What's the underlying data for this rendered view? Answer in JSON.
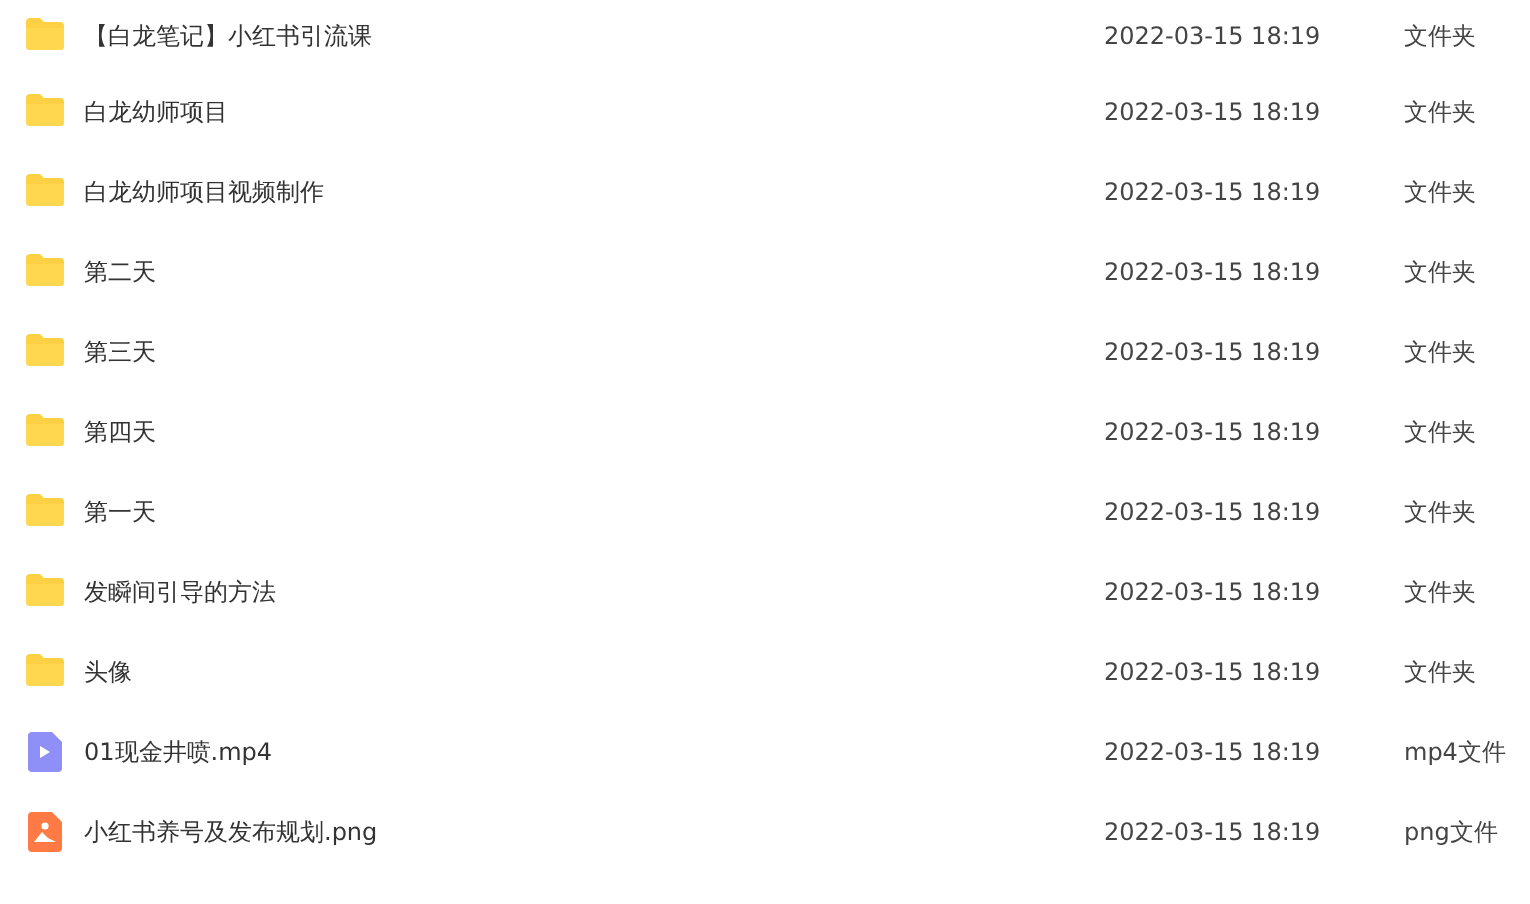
{
  "files": [
    {
      "kind": "folder",
      "name": "【白龙笔记】小红书引流课",
      "modified": "2022-03-15 18:19",
      "type": "文件夹"
    },
    {
      "kind": "folder",
      "name": "白龙幼师项目",
      "modified": "2022-03-15 18:19",
      "type": "文件夹"
    },
    {
      "kind": "folder",
      "name": "白龙幼师项目视频制作",
      "modified": "2022-03-15 18:19",
      "type": "文件夹"
    },
    {
      "kind": "folder",
      "name": "第二天",
      "modified": "2022-03-15 18:19",
      "type": "文件夹"
    },
    {
      "kind": "folder",
      "name": "第三天",
      "modified": "2022-03-15 18:19",
      "type": "文件夹"
    },
    {
      "kind": "folder",
      "name": "第四天",
      "modified": "2022-03-15 18:19",
      "type": "文件夹"
    },
    {
      "kind": "folder",
      "name": "第一天",
      "modified": "2022-03-15 18:19",
      "type": "文件夹"
    },
    {
      "kind": "folder",
      "name": "发瞬间引导的方法",
      "modified": "2022-03-15 18:19",
      "type": "文件夹"
    },
    {
      "kind": "folder",
      "name": "头像",
      "modified": "2022-03-15 18:19",
      "type": "文件夹"
    },
    {
      "kind": "video",
      "name": "01现金井喷.mp4",
      "modified": "2022-03-15 18:19",
      "type": "mp4文件"
    },
    {
      "kind": "image",
      "name": "小红书养号及发布规划.png",
      "modified": "2022-03-15 18:19",
      "type": "png文件"
    }
  ]
}
